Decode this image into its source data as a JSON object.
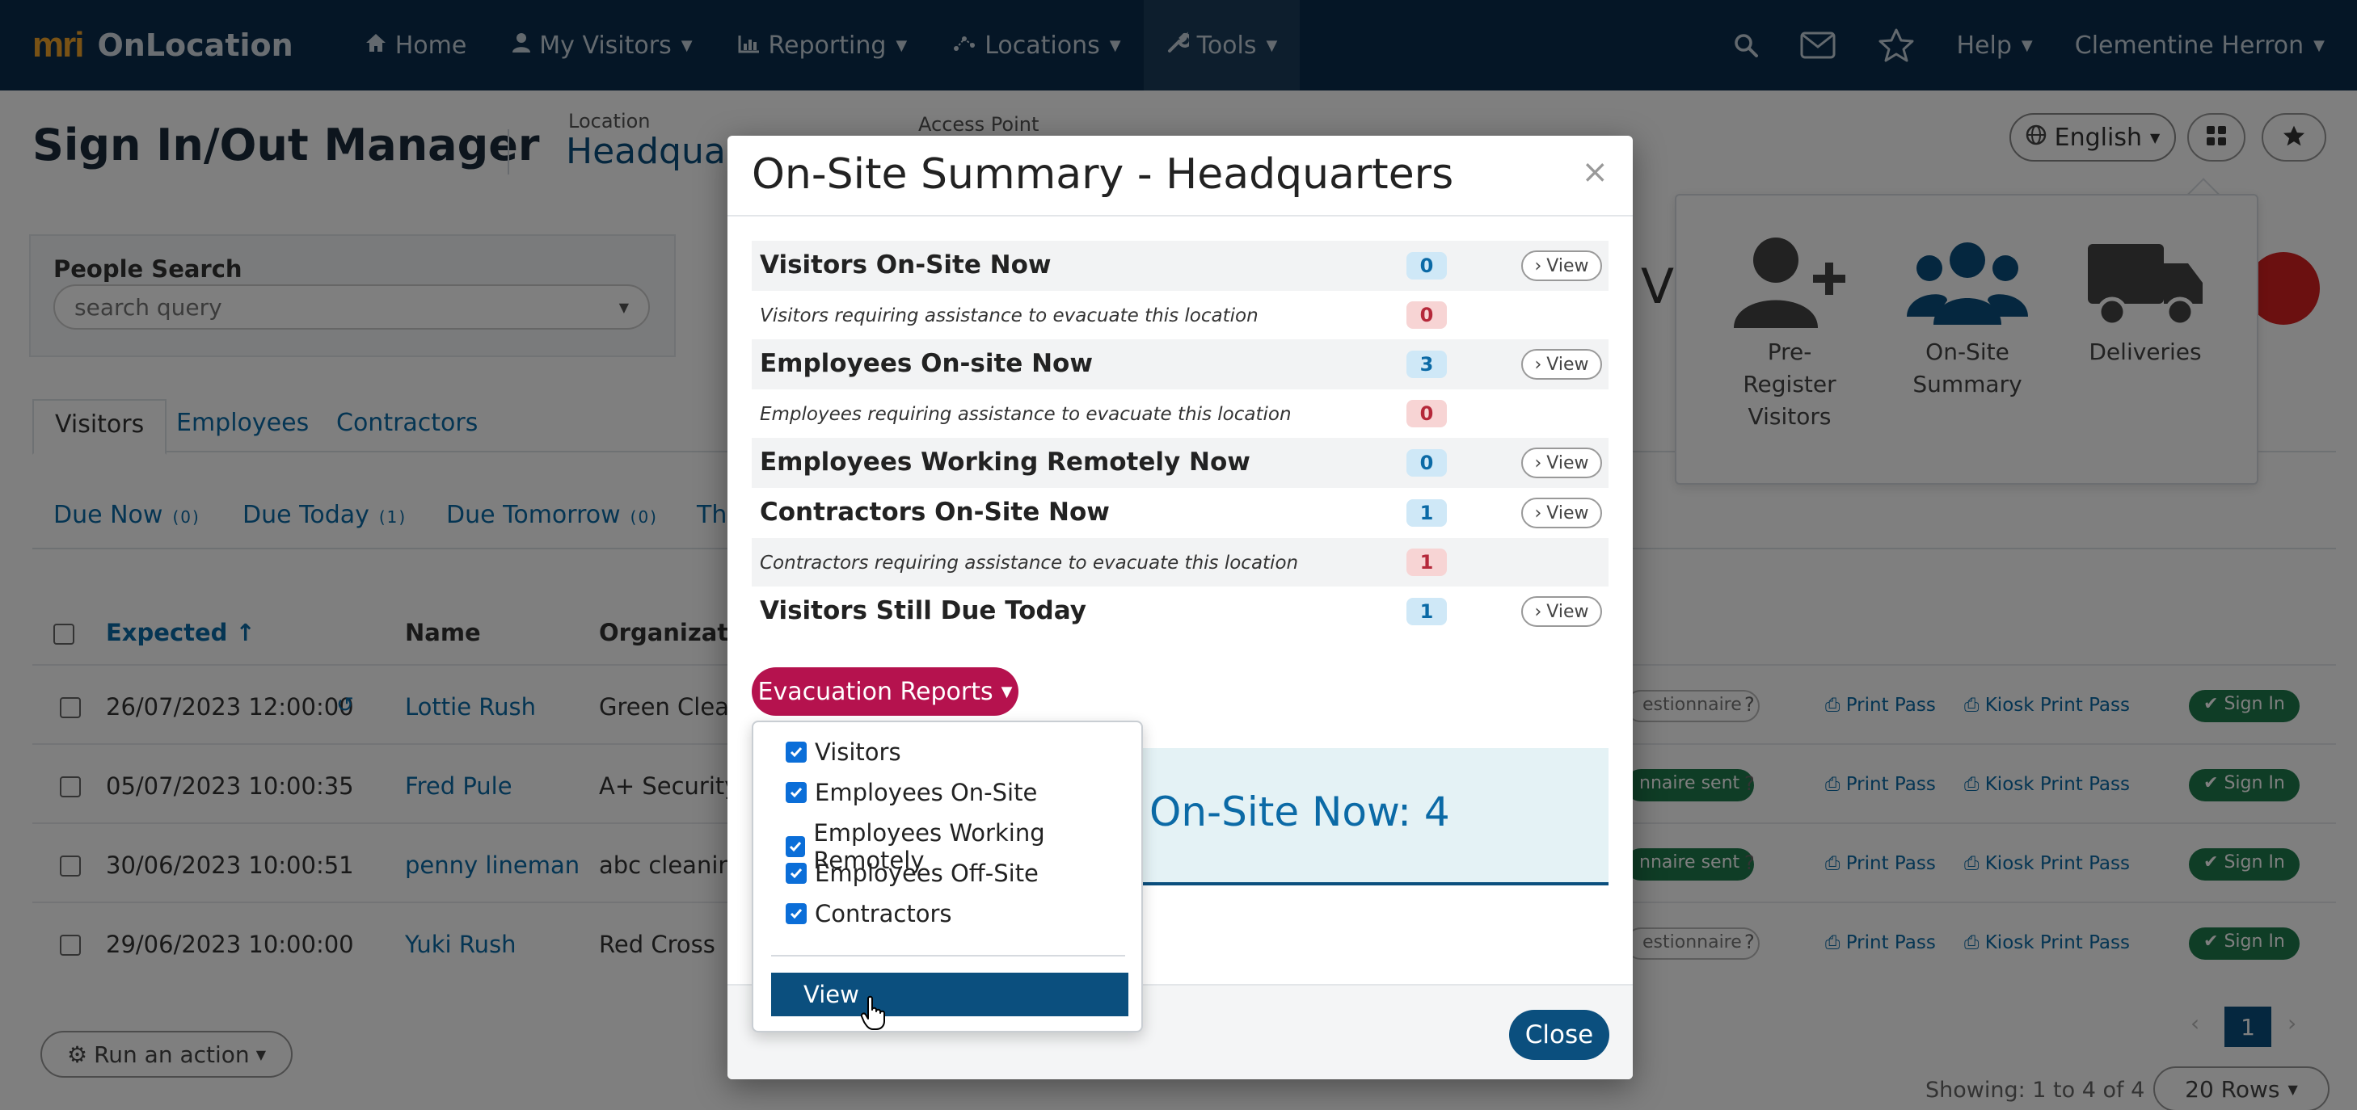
{
  "app": {
    "brand_logo": "mri",
    "brand_name": "OnLocation"
  },
  "nav": {
    "items": [
      {
        "icon": "home-icon",
        "label": "Home",
        "has_caret": false
      },
      {
        "icon": "user-icon",
        "label": "My Visitors",
        "has_caret": true
      },
      {
        "icon": "chart-icon",
        "label": "Reporting",
        "has_caret": true
      },
      {
        "icon": "map-icon",
        "label": "Locations",
        "has_caret": true
      },
      {
        "icon": "wrench-icon",
        "label": "Tools",
        "has_caret": true,
        "active": true
      }
    ],
    "help_label": "Help",
    "user_name": "Clementine Herron"
  },
  "page": {
    "title": "Sign In/Out Manager",
    "location_label": "Location",
    "location_value": "Headquarters",
    "access_point_label": "Access Point",
    "language": "English",
    "search_label": "People Search",
    "search_placeholder": "search query",
    "visit_fragment": "Visi",
    "tabs": [
      "Visitors",
      "Employees",
      "Contractors"
    ],
    "subtabs": [
      {
        "label": "Due Now",
        "count": "(0)"
      },
      {
        "label": "Due Today",
        "count": "(1)"
      },
      {
        "label": "Due Tomorrow",
        "count": "(0)"
      },
      {
        "label": "Thi",
        "count": ""
      }
    ],
    "columns": {
      "expected": "Expected ↑",
      "name": "Name",
      "organization": "Organizatio"
    },
    "rows": [
      {
        "expected": "26/07/2023 12:00:00",
        "name": "Lottie Rush",
        "org": "Green Clean",
        "status": "estionnaire",
        "status_type": "outline",
        "recurring": true
      },
      {
        "expected": "05/07/2023 10:00:35",
        "name": "Fred Pule",
        "org": "A+ Security",
        "status": "nnaire sent",
        "status_type": "green",
        "recurring": false
      },
      {
        "expected": "30/06/2023 10:00:51",
        "name": "penny lineman",
        "org": "abc cleaning",
        "status": "nnaire sent",
        "status_type": "green",
        "recurring": false
      },
      {
        "expected": "29/06/2023 10:00:00",
        "name": "Yuki Rush",
        "org": "Red Cross",
        "status": "estionnaire",
        "status_type": "outline",
        "recurring": false
      }
    ],
    "print_pass": "Print Pass",
    "kiosk_print_pass": "Kiosk Print Pass",
    "sign_in": "Sign In",
    "run_action": "Run an action",
    "page_number": "1",
    "showing": "Showing: 1 to 4 of 4",
    "rows_per_page": "20 Rows"
  },
  "quick_launch": [
    {
      "icon": "user-plus-icon",
      "label": "Pre-\nRegister\nVisitors"
    },
    {
      "icon": "users-icon",
      "label": "On-Site\nSummary"
    },
    {
      "icon": "truck-icon",
      "label": "Deliveries"
    }
  ],
  "modal": {
    "title": "On-Site Summary - Headquarters",
    "close_x": "×",
    "rows": [
      {
        "label": "Visitors On-Site Now",
        "count": "0",
        "kind": "main",
        "badge": "blue",
        "view": true
      },
      {
        "label": "Visitors requiring assistance to evacuate this location",
        "count": "0",
        "kind": "sub",
        "badge": "red",
        "view": false
      },
      {
        "label": "Employees On-site Now",
        "count": "3",
        "kind": "main",
        "badge": "blue",
        "view": true
      },
      {
        "label": "Employees requiring assistance to evacuate this location",
        "count": "0",
        "kind": "sub",
        "badge": "red",
        "view": false
      },
      {
        "label": "Employees Working Remotely Now",
        "count": "0",
        "kind": "main",
        "badge": "blue",
        "view": true
      },
      {
        "label": "Contractors On-Site Now",
        "count": "1",
        "kind": "main",
        "badge": "blue",
        "view": true
      },
      {
        "label": "Contractors requiring assistance to evacuate this location",
        "count": "1",
        "kind": "sub",
        "badge": "red",
        "view": false
      },
      {
        "label": "Visitors Still Due Today",
        "count": "1",
        "kind": "main",
        "badge": "blue",
        "view": true
      }
    ],
    "view_label": "View",
    "evac_button": "Evacuation Reports",
    "info_text": "On-Site Now: 4",
    "close_button": "Close"
  },
  "dropdown": {
    "options": [
      {
        "label": "Visitors",
        "checked": true
      },
      {
        "label": "Employees On-Site",
        "checked": true
      },
      {
        "label": "Employees Working Remotely",
        "checked": true
      },
      {
        "label": "Employees Off-Site",
        "checked": true
      },
      {
        "label": "Contractors",
        "checked": true
      }
    ],
    "view_button": "View"
  },
  "colors": {
    "navbar": "#0a2d4d",
    "primary": "#0b4f7e",
    "evac_button": "#b5124e",
    "sign_in_green": "#1f7a4d",
    "link": "#0b6aa6"
  }
}
